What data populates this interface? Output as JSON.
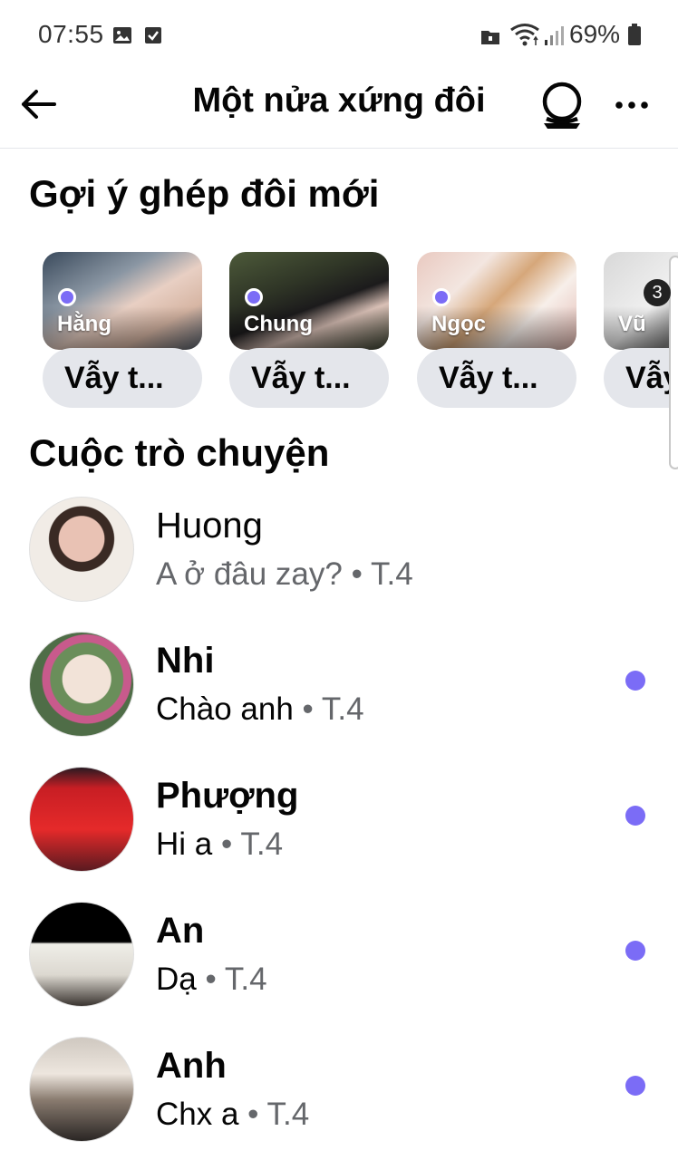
{
  "status_bar": {
    "time": "07:55",
    "battery": "69%",
    "icons": [
      "gallery-icon",
      "check-box-icon",
      "folder-icon",
      "wifi-icon",
      "signal-icon",
      "battery-icon"
    ]
  },
  "header": {
    "title": "Một nửa xứng đôi",
    "icons": [
      "back-arrow-icon",
      "crystal-ball-icon",
      "more-dots-icon"
    ]
  },
  "suggestions": {
    "title": "Gợi ý ghép đôi mới",
    "items": [
      {
        "name": "Hằng",
        "button": "Vẫy t..."
      },
      {
        "name": "Chung",
        "button": "Vẫy t..."
      },
      {
        "name": "Ngọc",
        "button": "Vẫy t..."
      },
      {
        "name": "Vũ",
        "button": "Vẫy t...",
        "badge": "3"
      }
    ]
  },
  "conversations": {
    "title": "Cuộc trò chuyện",
    "items": [
      {
        "name": "Huong",
        "message": "A ở đâu zay?",
        "sep": "•",
        "time": "T.4",
        "unread": false
      },
      {
        "name": "Nhi",
        "message": "Chào anh",
        "sep": "•",
        "time": "T.4",
        "unread": true
      },
      {
        "name": "Phượng",
        "message": "Hi a",
        "sep": "•",
        "time": "T.4",
        "unread": true
      },
      {
        "name": "An",
        "message": "Dạ",
        "sep": "•",
        "time": "T.4",
        "unread": true
      },
      {
        "name": "Anh",
        "message": "Chx a",
        "sep": "•",
        "time": "T.4",
        "unread": true
      }
    ]
  },
  "colors": {
    "accent": "#7b6cf6",
    "chip_bg": "#e4e6eb",
    "secondary_text": "#65676b"
  }
}
